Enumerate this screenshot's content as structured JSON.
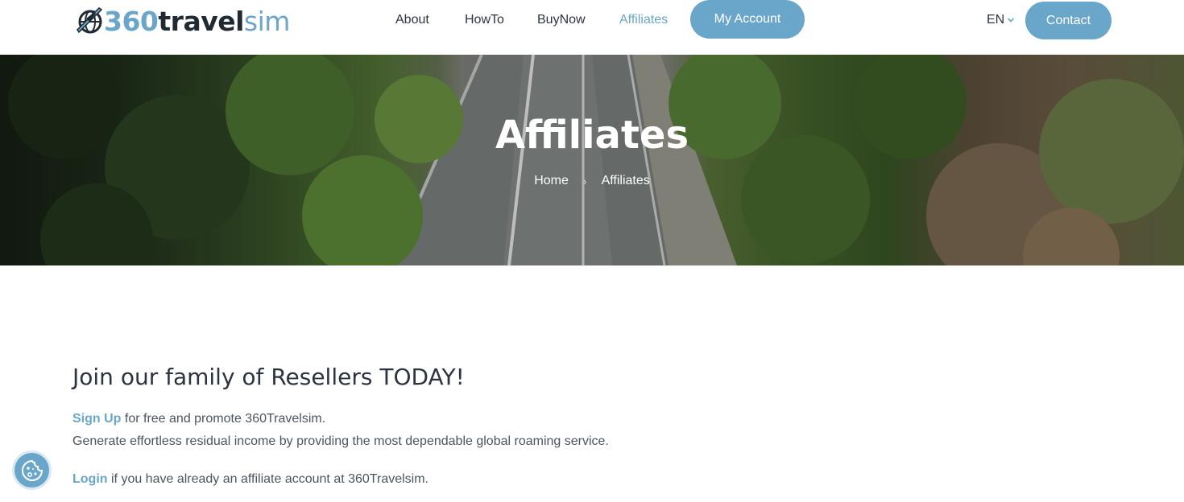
{
  "brand": {
    "logo_num": "360",
    "logo_travel": "travel",
    "logo_sim": "sim",
    "accent_color": "#6aa6c9"
  },
  "nav": {
    "items": [
      {
        "label": "About",
        "active": false
      },
      {
        "label": "HowTo",
        "active": false
      },
      {
        "label": "BuyNow",
        "active": false
      },
      {
        "label": "Affiliates",
        "active": true
      }
    ],
    "my_account": "My Account",
    "language": "EN",
    "contact": "Contact"
  },
  "hero": {
    "title": "Affiliates",
    "breadcrumb": [
      {
        "label": "Home"
      },
      {
        "label": "Affiliates"
      }
    ],
    "separator": "›"
  },
  "content": {
    "heading": "Join our family of Resellers TODAY!",
    "signup_link": "Sign Up",
    "signup_text": " for free and promote 360Travelsim.",
    "income_text": "Generate effortless residual income by providing the most dependable global roaming service.",
    "login_link": "Login",
    "login_text": " if you have already an affiliate account at 360Travelsim."
  },
  "icons": {
    "logo": "globe-plane-icon",
    "language_chevron": "chevron-down-icon",
    "cookie": "cookie-icon"
  }
}
